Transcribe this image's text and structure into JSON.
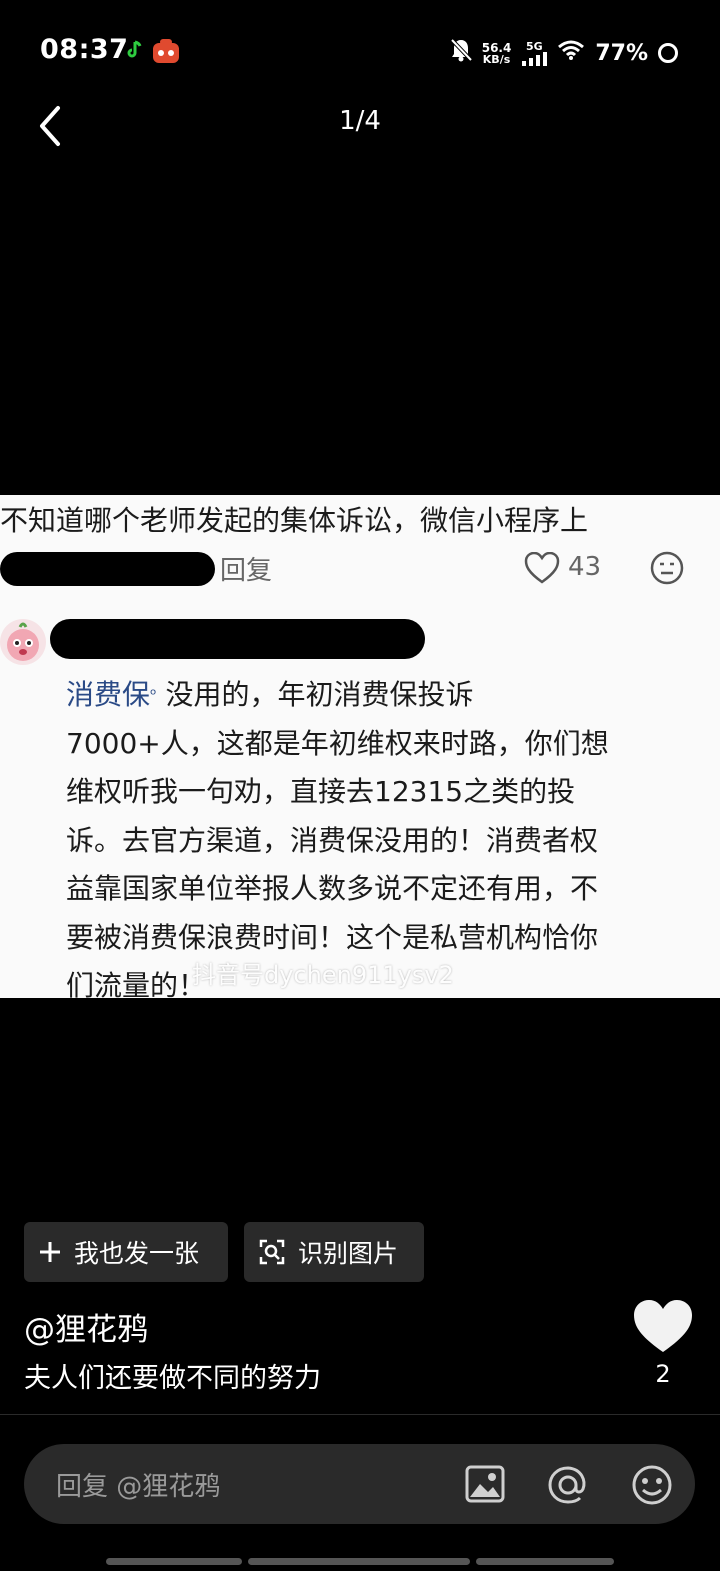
{
  "status_bar": {
    "time": "08:37",
    "net_speed_value": "56.4",
    "net_speed_unit": "KB/s",
    "network": "5G",
    "battery": "77%"
  },
  "nav": {
    "counter": "1/4"
  },
  "comment_image": {
    "line1": "不知道哪个老师发起的集体诉讼，微信小程序上",
    "reply_label": "回复",
    "like_count": "43",
    "body_link": "消费保",
    "body_lines": [
      "没用的，年初消费保投诉",
      "7000+人，这都是年初维权来时路，你们想",
      "维权听我一句劝，直接去12315之类的投",
      "诉。去官方渠道，消费保没用的！消费者权",
      "益靠国家单位举报人数多说不定还有用，不",
      "要被消费保浪费时间！这个是私营机构恰你",
      "们流量的！"
    ],
    "watermark": "抖音号dychen911ysv2"
  },
  "actions": {
    "post_label": "我也发一张",
    "recognize_label": "识别图片"
  },
  "post": {
    "author": "@狸花鸦",
    "caption": "夫人们还要做不同的努力",
    "like_count": "2"
  },
  "reply_input": {
    "placeholder": "回复 @狸花鸦"
  }
}
